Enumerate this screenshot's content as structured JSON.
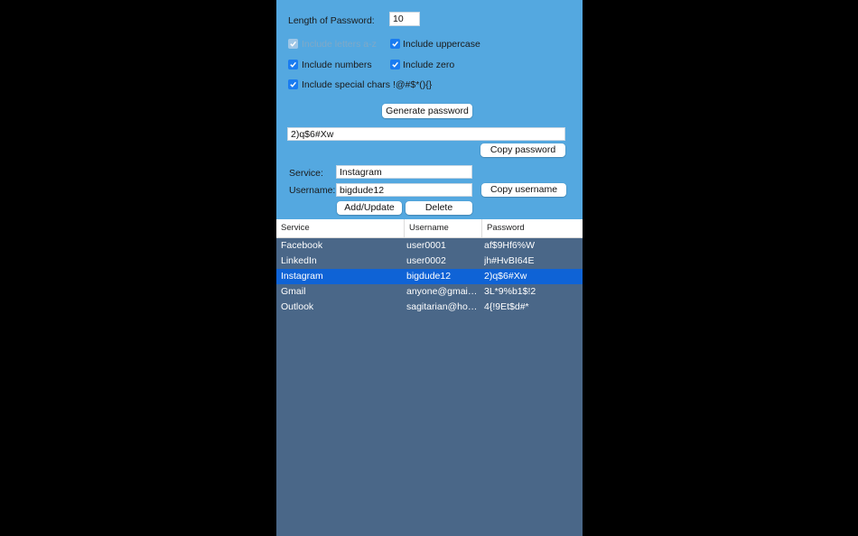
{
  "form": {
    "length_label": "Length of Password:",
    "length_value": "10",
    "options": [
      {
        "label": "Include letters a-z",
        "checked": true,
        "disabled": true
      },
      {
        "label": "Include uppercase",
        "checked": true,
        "disabled": false
      },
      {
        "label": "Include numbers",
        "checked": true,
        "disabled": false
      },
      {
        "label": "Include zero",
        "checked": true,
        "disabled": false
      },
      {
        "label": "Include special chars !@#$*(){}",
        "checked": true,
        "disabled": false
      }
    ],
    "generate_label": "Generate password",
    "generated_password": "2)q$6#Xw",
    "copy_password_label": "Copy password",
    "service_label": "Service:",
    "service_value": "Instagram",
    "username_label": "Username:",
    "username_value": "bigdude12",
    "copy_username_label": "Copy username",
    "add_update_label": "Add/Update",
    "delete_label": "Delete"
  },
  "table": {
    "columns": [
      "Service",
      "Username",
      "Password"
    ],
    "rows": [
      {
        "service": "Facebook",
        "username": "user0001",
        "password": "af$9Hf6%W",
        "selected": false
      },
      {
        "service": "LinkedIn",
        "username": "user0002",
        "password": "jh#HvBI64E",
        "selected": false
      },
      {
        "service": "Instagram",
        "username": "bigdude12",
        "password": "2)q$6#Xw",
        "selected": true
      },
      {
        "service": "Gmail",
        "username": "anyone@gmail.c...",
        "password": "3L*9%b1$!2",
        "selected": false
      },
      {
        "service": "Outlook",
        "username": "sagitarian@hotm...",
        "password": "4{!9Et$d#*",
        "selected": false
      }
    ]
  },
  "colors": {
    "panel_bg": "#54a8e0",
    "list_bg": "#4a6788",
    "selection": "#0f63d6",
    "checkbox": "#1a7cf0"
  }
}
